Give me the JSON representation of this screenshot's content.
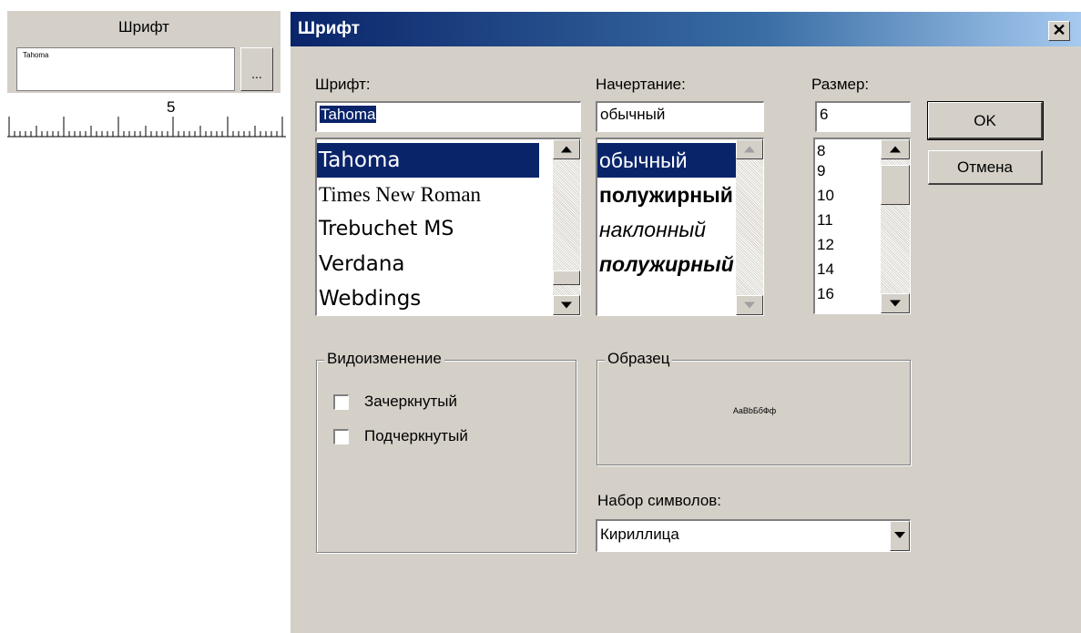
{
  "property_panel": {
    "title": "Шрифт",
    "value": "Tahoma",
    "browse_label": "...",
    "ruler_mark": "5"
  },
  "dialog": {
    "title": "Шрифт",
    "close_glyph": "✕",
    "font": {
      "label": "Шрифт:",
      "value": "Tahoma",
      "items": [
        "Tahoma",
        "Times New Roman",
        "Trebuchet MS",
        "Verdana",
        "Webdings"
      ],
      "selected_index": 0
    },
    "style": {
      "label": "Начертание:",
      "value": "обычный",
      "items": [
        "обычный",
        "полужирный",
        "наклонный",
        "полужирный наклонный"
      ],
      "selected_index": 0
    },
    "size": {
      "label": "Размер:",
      "value": "6",
      "items": [
        "8",
        "9",
        "10",
        "11",
        "12",
        "14",
        "16"
      ]
    },
    "ok_label": "OK",
    "cancel_label": "Отмена",
    "effects": {
      "title": "Видоизменение",
      "strikeout_label": "Зачеркнутый",
      "underline_label": "Подчеркнутый",
      "strikeout_checked": false,
      "underline_checked": false
    },
    "sample": {
      "title": "Образец",
      "text": "AaBbБбФф"
    },
    "charset": {
      "label": "Набор символов:",
      "value": "Кириллица"
    }
  },
  "colors": {
    "face": "#d4d0c8",
    "selection": "#0a246a",
    "title_start": "#0a246a",
    "title_end": "#a6caf0"
  }
}
